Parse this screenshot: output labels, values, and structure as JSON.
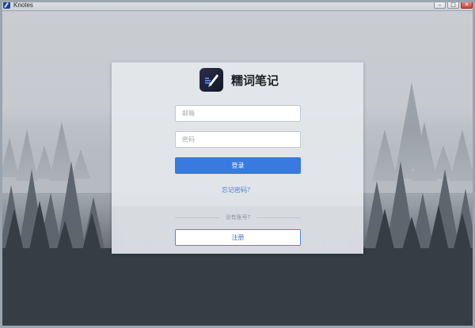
{
  "window": {
    "title": "Knotes",
    "controls": {
      "minimize": "–",
      "maximize": "□",
      "close": "✕"
    }
  },
  "brand": {
    "name": "糯词笔记",
    "logo_icon": "pen-notebook-icon"
  },
  "login": {
    "email_placeholder": "邮箱",
    "email_value": "",
    "password_placeholder": "密码",
    "password_value": "",
    "login_button": "登录",
    "forgot_password": "忘记密码？"
  },
  "register": {
    "prompt": "没有账号?",
    "register_button": "注册"
  },
  "colors": {
    "primary": "#3a7ae0",
    "link": "#4a7fd6",
    "logo_bg": "#1d2035"
  }
}
